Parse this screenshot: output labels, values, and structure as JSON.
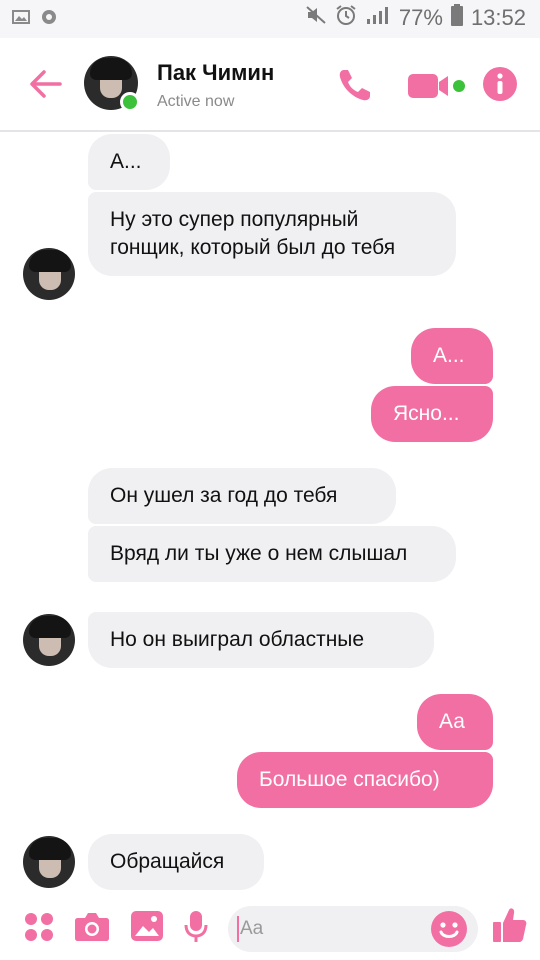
{
  "status_bar": {
    "battery_percent": "77%",
    "time": "13:52"
  },
  "header": {
    "contact_name": "Пак Чимин",
    "contact_status": "Active now"
  },
  "messages": [
    {
      "side": "in",
      "text": "А..."
    },
    {
      "side": "in",
      "text": "Ну это супер популярный гонщик, который был до тебя"
    },
    {
      "side": "out",
      "text": "А..."
    },
    {
      "side": "out",
      "text": "Ясно..."
    },
    {
      "side": "in",
      "text": "Он ушел за год до тебя"
    },
    {
      "side": "in",
      "text": "Вряд ли ты уже о нем слышал"
    },
    {
      "side": "in",
      "text": "Но он выиграл областные"
    },
    {
      "side": "out",
      "text": "Аа"
    },
    {
      "side": "out",
      "text": "Большое спасибо)"
    },
    {
      "side": "in",
      "text": "Обращайся"
    }
  ],
  "composer": {
    "placeholder": "Aa"
  },
  "colors": {
    "accent": "#f26fa3",
    "incoming_bubble": "#f0f0f3",
    "online": "#3cc13b"
  },
  "icons": [
    "back-arrow-icon",
    "phone-icon",
    "video-camera-icon",
    "info-icon",
    "apps-icon",
    "camera-icon",
    "gallery-icon",
    "microphone-icon",
    "emoji-icon",
    "thumbs-up-icon"
  ]
}
